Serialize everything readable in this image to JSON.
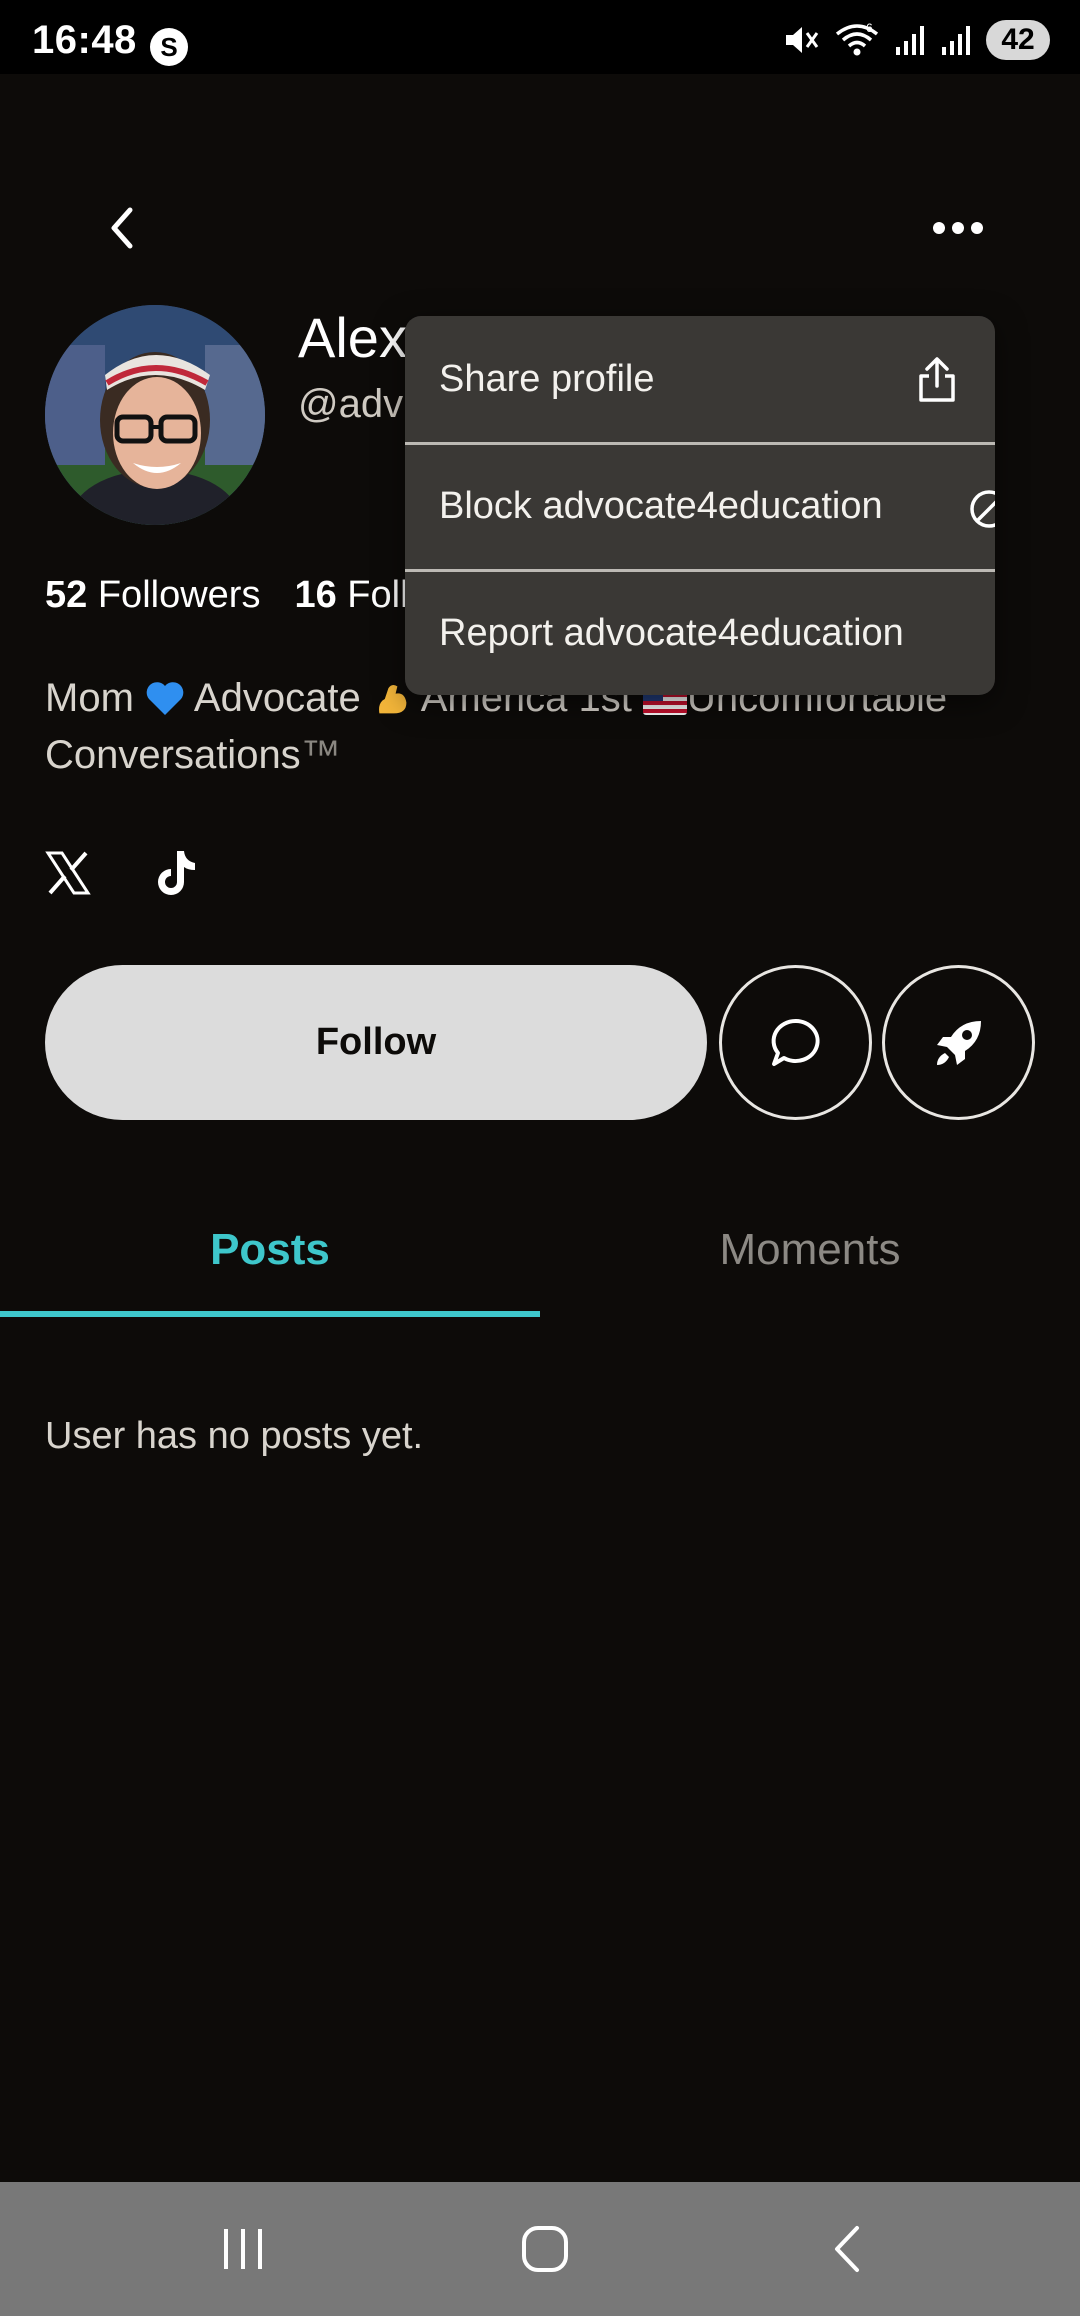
{
  "status_bar": {
    "time": "16:48",
    "app_badge": "S",
    "battery": "42",
    "icons": [
      "mute-icon",
      "wifi-icon",
      "signal-icon",
      "signal-icon",
      "battery-icon"
    ]
  },
  "header": {
    "back_icon": "chevron-left-icon",
    "more_icon": "more-horizontal-icon"
  },
  "profile": {
    "name": "Alex",
    "handle": "@adv",
    "followers_count": "52",
    "followers_label": "Followers",
    "following_count": "16",
    "following_label": "Foll",
    "bio_part1": "Mom ",
    "bio_part2": " Advocate ",
    "bio_part3": " America 1st ",
    "bio_part4": "Uncomfortable Conversations",
    "bio_tm": "™",
    "social_links": [
      "x-icon",
      "tiktok-icon"
    ]
  },
  "actions": {
    "follow_label": "Follow",
    "message_icon": "message-icon",
    "boost_icon": "rocket-icon"
  },
  "tabs": [
    {
      "label": "Posts",
      "active": true
    },
    {
      "label": "Moments",
      "active": false
    }
  ],
  "content": {
    "empty_message": "User has no posts yet."
  },
  "menu": {
    "items": [
      {
        "label": "Share profile",
        "icon": "share-icon"
      },
      {
        "label": "Block advocate4education",
        "icon": "block-icon"
      },
      {
        "label": "Report advocate4education",
        "icon": ""
      }
    ]
  },
  "nav_bar": {
    "buttons": [
      "recents-icon",
      "home-icon",
      "back-icon"
    ]
  },
  "colors": {
    "background": "#0d0b09",
    "accent": "#3ec7cb",
    "menu_bg": "#3a3835",
    "follow_bg": "#dcdcdc"
  }
}
